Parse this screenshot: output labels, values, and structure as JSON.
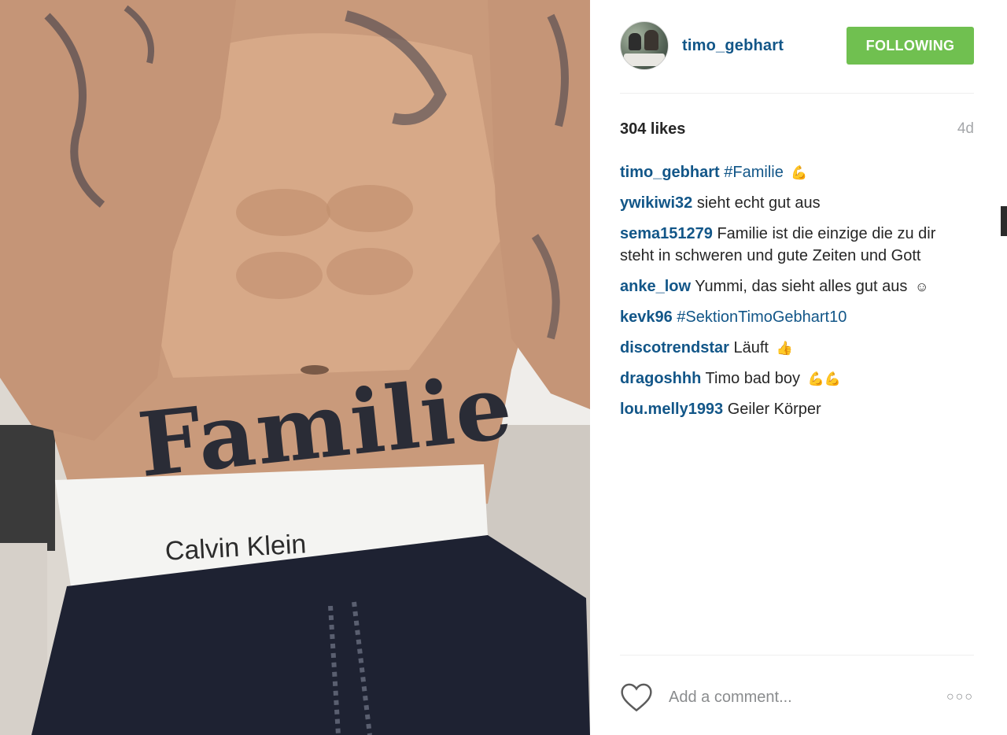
{
  "post": {
    "image_alt": "Photo of a tattooed torso with Familie lettering above a waistband",
    "image_text": {
      "tattoo": "Familie",
      "waistband": "Calvin Klein"
    }
  },
  "header": {
    "username": "timo_gebhart",
    "follow_label": "FOLLOWING"
  },
  "stats": {
    "likes": "304 likes",
    "time_ago": "4d"
  },
  "comments": [
    {
      "user": "timo_gebhart",
      "text": "",
      "hashtag": "#Familie",
      "emoji": "flexed-biceps",
      "emoji_glyph": "💪"
    },
    {
      "user": "ywikiwi32",
      "text": "sieht echt gut aus"
    },
    {
      "user": "sema151279",
      "text": "Familie ist die einzige die zu dir steht in schweren und gute Zeiten und Gott"
    },
    {
      "user": "anke_low",
      "text": "Yummi, das sieht alles gut aus",
      "emoji": "smiling-face",
      "emoji_glyph": "☺"
    },
    {
      "user": "kevk96",
      "text": "",
      "hashtag": "#SektionTimoGebhart10"
    },
    {
      "user": "discotrendstar",
      "text": "Läuft",
      "emoji": "hand-pointing",
      "emoji_glyph": "👍"
    },
    {
      "user": "dragoshhh",
      "text": "Timo bad boy",
      "emoji": "flexed-biceps-x2",
      "emoji_glyph": "💪💪"
    },
    {
      "user": "lou.melly1993",
      "text": "Geiler Körper"
    }
  ],
  "footer": {
    "comment_placeholder": "Add a comment...",
    "more_label": "○○○"
  },
  "colors": {
    "link": "#125688",
    "follow_button": "#70c050",
    "muted": "#a5a7aa"
  }
}
